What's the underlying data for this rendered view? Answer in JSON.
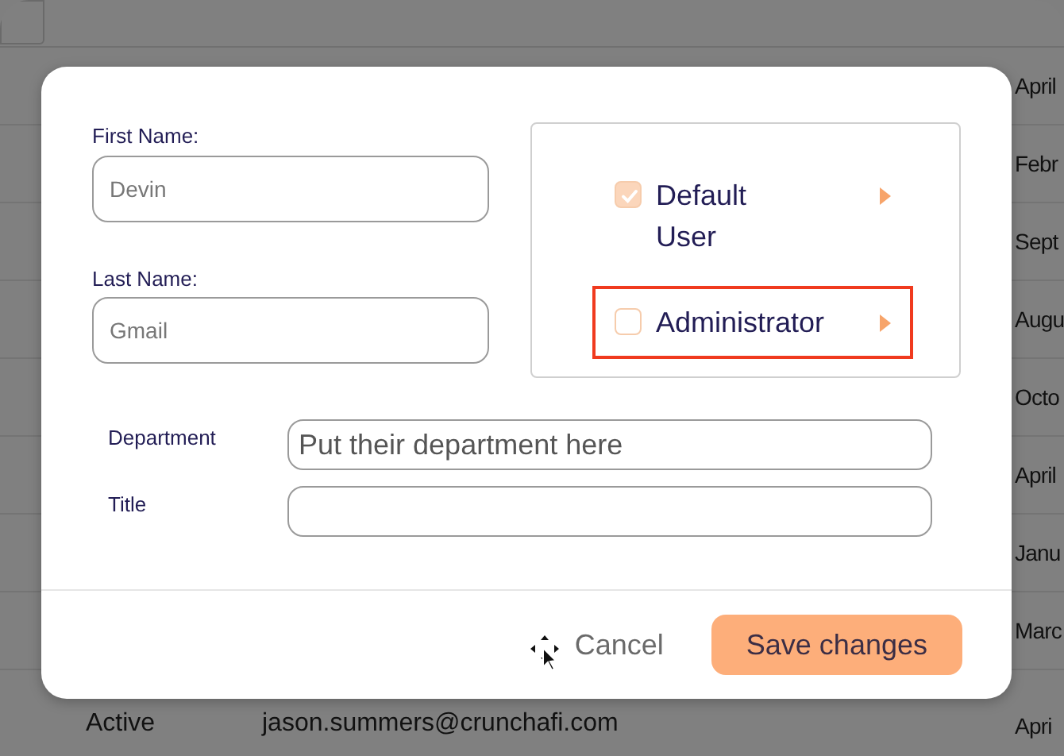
{
  "background_table": {
    "header_checkbox": {
      "checked": false
    },
    "rows": [
      {
        "date": "April"
      },
      {
        "date": "Febr"
      },
      {
        "date": "Sept"
      },
      {
        "date": "Augu"
      },
      {
        "date": "Octo"
      },
      {
        "date": "April"
      },
      {
        "date": "Janu"
      },
      {
        "date": "Marc"
      },
      {
        "status": "Active",
        "email": "jason.summers@crunchafi.com",
        "date": "Apri"
      }
    ]
  },
  "modal": {
    "name_fields": [
      {
        "label": "First Name:",
        "placeholder": "Devin"
      },
      {
        "label": "Last Name:",
        "placeholder": "Gmail"
      }
    ],
    "roles": [
      {
        "label": "Default User",
        "checked": true,
        "highlighted": false
      },
      {
        "label": "Administrator",
        "checked": false,
        "highlighted": true
      }
    ],
    "detail_fields": [
      {
        "label": "Department",
        "placeholder": "Put their department here"
      },
      {
        "label": "Title"
      }
    ],
    "buttons": [
      {
        "kind": "secondary",
        "label": "Cancel"
      },
      {
        "kind": "primary",
        "label": "Save changes"
      }
    ]
  }
}
